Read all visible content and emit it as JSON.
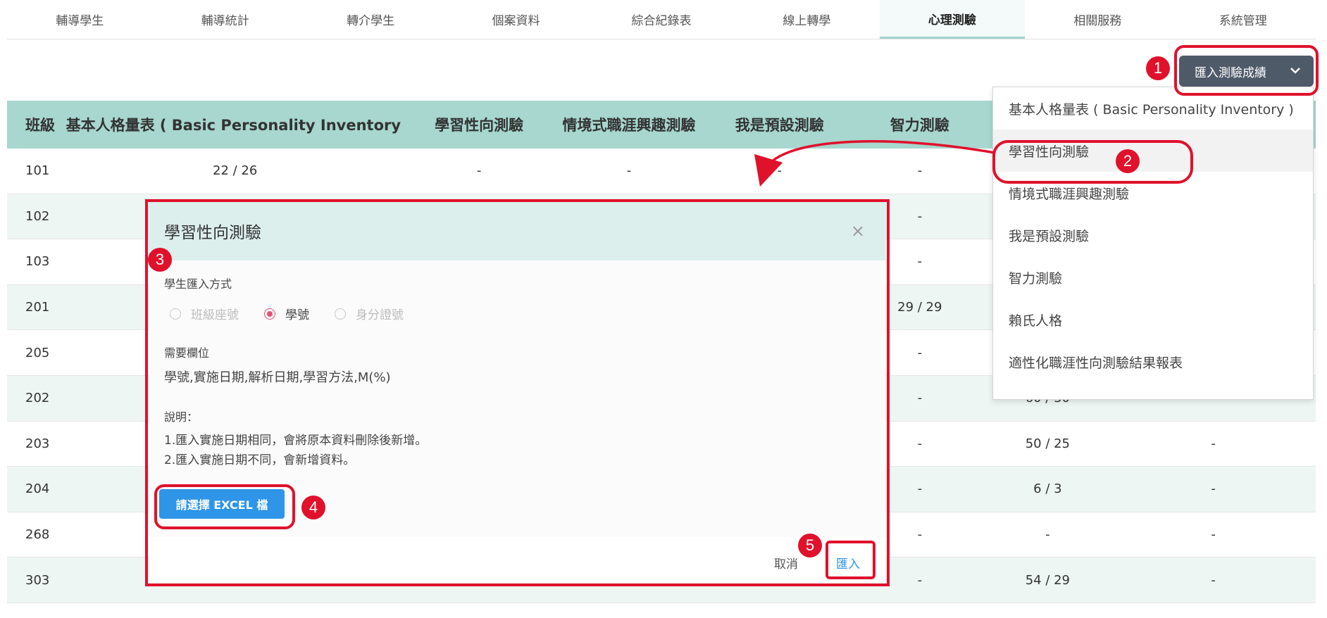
{
  "nav": {
    "tabs": [
      "輔導學生",
      "輔導統計",
      "轉介學生",
      "個案資料",
      "綜合紀錄表",
      "線上轉學",
      "心理測驗",
      "相關服務",
      "系統管理"
    ],
    "active_index": 6
  },
  "import_button": {
    "label": "匯入測驗成績",
    "icon": "chevron-down-icon"
  },
  "table": {
    "headers": [
      "班級",
      "基本人格量表 ( Basic Personality Inventory )",
      "學習性向測驗",
      "情境式職涯興趣測驗",
      "我是預設測驗",
      "智力測驗",
      "",
      ""
    ],
    "rows": [
      [
        "101",
        "22 / 26",
        "-",
        "-",
        "-",
        "-",
        "",
        ""
      ],
      [
        "102",
        "",
        "",
        "",
        "",
        "-",
        "",
        ""
      ],
      [
        "103",
        "",
        "",
        "",
        "",
        "-",
        "",
        ""
      ],
      [
        "201",
        "",
        "",
        "",
        "",
        "29 / 29",
        "",
        ""
      ],
      [
        "205",
        "",
        "",
        "",
        "",
        "-",
        "",
        ""
      ],
      [
        "202",
        "",
        "",
        "",
        "",
        "-",
        "60 / 30",
        "-"
      ],
      [
        "203",
        "",
        "",
        "",
        "",
        "-",
        "50 / 25",
        "-"
      ],
      [
        "204",
        "",
        "",
        "",
        "",
        "-",
        "6 / 3",
        "-"
      ],
      [
        "268",
        "",
        "",
        "",
        "",
        "-",
        "-",
        "-"
      ],
      [
        "303",
        "",
        "",
        "",
        "",
        "-",
        "54 / 29",
        "-"
      ]
    ]
  },
  "dropdown": {
    "items": [
      "基本人格量表 ( Basic Personality Inventory )",
      "學習性向測驗",
      "情境式職涯興趣測驗",
      "我是預設測驗",
      "智力測驗",
      "賴氏人格",
      "適性化職涯性向測驗結果報表"
    ],
    "highlighted_index": 1
  },
  "modal": {
    "title": "學習性向測驗",
    "close_symbol": "×",
    "import_method_label": "學生匯入方式",
    "radio_options": [
      "班級座號",
      "學號",
      "身分證號"
    ],
    "selected_radio": 1,
    "required_fields_label": "需要欄位",
    "required_fields": "學號,實施日期,解析日期,學習方法,M(%)",
    "note_label": "說明：",
    "note_1": "1.匯入實施日期相同，會將原本資料刪除後新增。",
    "note_2": "2.匯入實施日期不同，會新增資料。",
    "excel_button": "請選擇 EXCEL 檔",
    "cancel_button": "取消",
    "import_button": "匯入"
  },
  "annotations": [
    "1",
    "2",
    "3",
    "4",
    "5"
  ],
  "colors": {
    "accent_red": "#e0112b",
    "header_teal": "#a7d7cf",
    "primary_blue": "#2e95e8",
    "button_dark": "#4f5a69"
  }
}
